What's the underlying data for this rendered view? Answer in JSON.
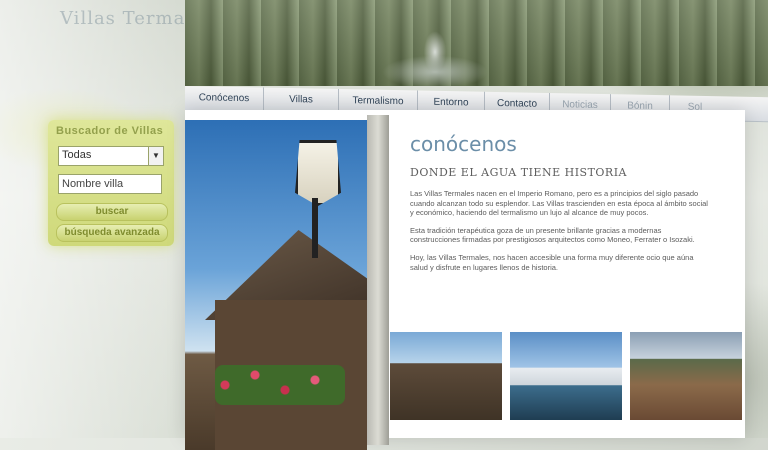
{
  "logo_text": "Villas Termales",
  "nav": {
    "items": [
      "Conócenos",
      "Villas",
      "Termalismo",
      "Entorno",
      "Contacto",
      "Noticias",
      "Bónin",
      "Sol"
    ]
  },
  "search": {
    "title": "Buscador de Villas",
    "select_value": "Todas",
    "input_value": "Nombre villa",
    "search_button": "buscar",
    "advanced_button": "búsqueda avanzada"
  },
  "content": {
    "title": "conócenos",
    "subtitle": "DONDE EL AGUA TIENE HISTORIA",
    "paragraphs": [
      "Las Villas Termales nacen en el Imperio Romano, pero es a principios del siglo pasado cuando alcanzan todo su esplendor. Las Villas trascienden en esta época al ámbito social y económico, haciendo del termalismo un lujo al alcance de muy pocos.",
      "Esta tradición terapéutica goza de un presente brillante gracias a modernas construcciones firmadas por prestigiosos arquitectos como Moneo, Ferrater o Isozaki.",
      "Hoy, las Villas Termales, nos hacen accesible una forma muy diferente ocio que aúna salud y disfrute en lugares llenos de historia."
    ]
  },
  "colors": {
    "accent": "#6b8ea8",
    "search_panel": "#d8e18a",
    "nav_text": "#33465a"
  }
}
